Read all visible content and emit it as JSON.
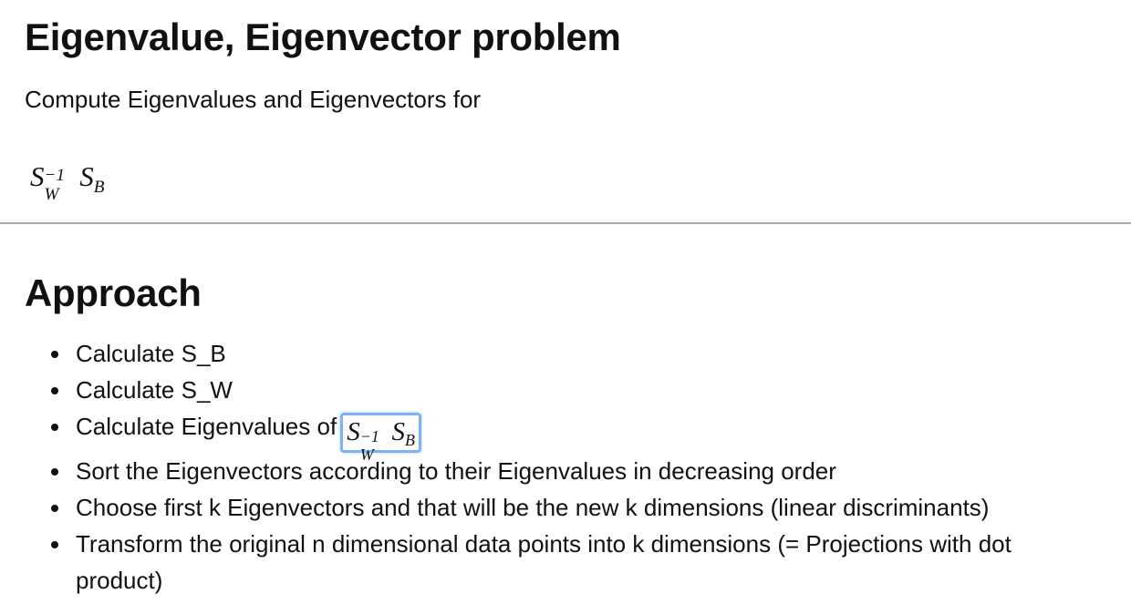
{
  "section1": {
    "title": "Eigenvalue, Eigenvector problem",
    "intro": "Compute Eigenvalues and Eigenvectors for",
    "formula": {
      "base1": "S",
      "sup1": "−1",
      "sub1": "W",
      "base2": "S",
      "sub2": "B"
    }
  },
  "section2": {
    "title": "Approach",
    "steps": [
      "Calculate S_B",
      "Calculate S_W",
      "Calculate Eigenvalues of",
      "Sort the Eigenvectors according to their Eigenvalues in decreasing order",
      "Choose first k Eigenvectors and that will be the new k dimensions (linear discriminants)",
      "Transform the original n dimensional data points into k dimensions (= Projections with dot product)"
    ]
  },
  "colors": {
    "text": "#111111",
    "rule": "#a9a9a9",
    "highlight_border": "#7fb3f7"
  }
}
